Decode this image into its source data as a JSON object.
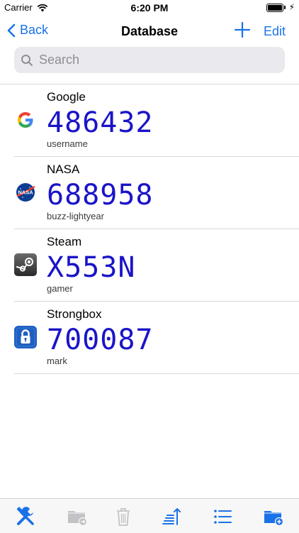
{
  "status_bar": {
    "carrier": "Carrier",
    "time": "6:20 PM"
  },
  "nav": {
    "back_label": "Back",
    "title": "Database",
    "edit_label": "Edit"
  },
  "search": {
    "placeholder": "Search",
    "value": ""
  },
  "entries": [
    {
      "name": "Google",
      "code": "486432",
      "username": "username",
      "logo": "google-logo"
    },
    {
      "name": "NASA",
      "code": "688958",
      "username": "buzz-lightyear",
      "logo": "nasa-logo"
    },
    {
      "name": "Steam",
      "code": "X553N",
      "username": "gamer",
      "logo": "steam-logo"
    },
    {
      "name": "Strongbox",
      "code": "700087",
      "username": "mark",
      "logo": "strongbox-logo"
    }
  ],
  "toolbar": {
    "items": [
      {
        "icon": "tools-icon",
        "enabled": true
      },
      {
        "icon": "move-folder-icon",
        "enabled": false
      },
      {
        "icon": "trash-icon",
        "enabled": false
      },
      {
        "icon": "sort-icon",
        "enabled": true
      },
      {
        "icon": "list-icon",
        "enabled": true
      },
      {
        "icon": "new-folder-icon",
        "enabled": true
      }
    ]
  },
  "colors": {
    "accent": "#1a72e8",
    "code": "#1a14c8",
    "disabled": "#c3c3c7"
  }
}
